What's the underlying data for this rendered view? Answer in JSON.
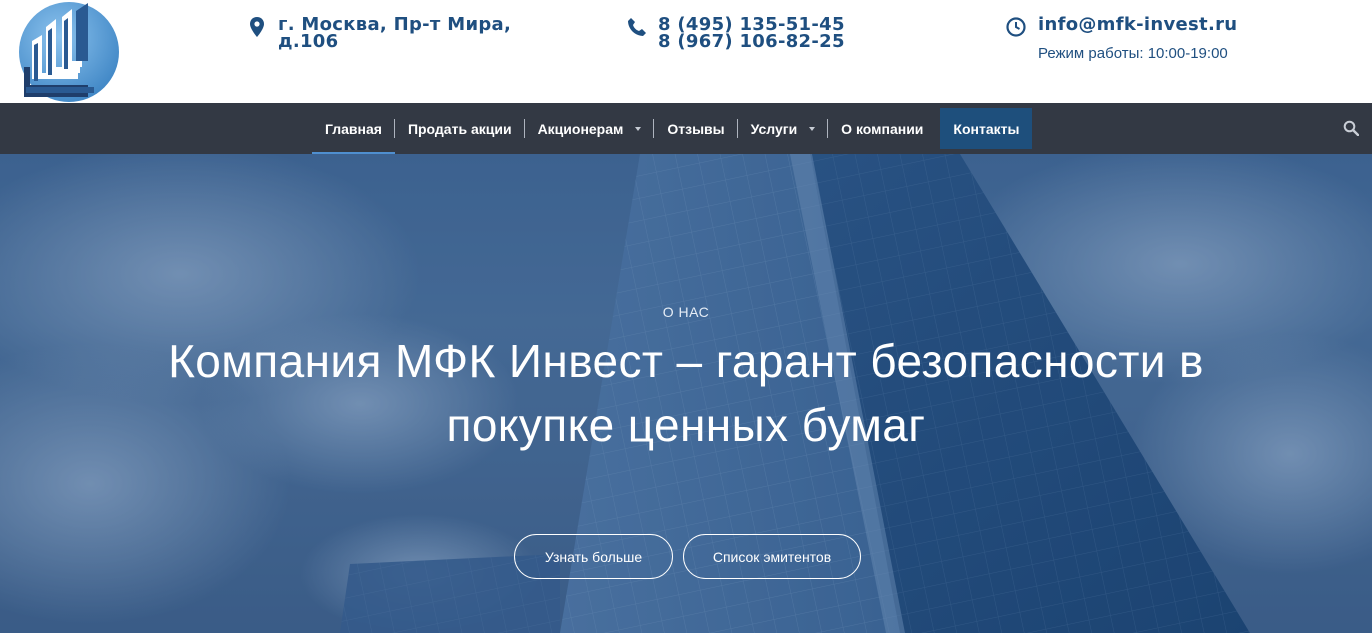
{
  "header": {
    "address": {
      "line1": "г. Москва, Пр-т Мира,",
      "line2": "д.106",
      "icon": "map-marker-icon"
    },
    "phones": {
      "line1": "8 (495) 135-51-45",
      "line2": "8 (967) 106-82-25",
      "icon": "phone-icon"
    },
    "contact": {
      "email": "info@mfk-invest.ru",
      "hours": "Режим работы: 10:00-19:00",
      "icon": "clock-icon"
    }
  },
  "nav": {
    "items": [
      {
        "label": "Главная",
        "dropdown": false,
        "active": true
      },
      {
        "label": "Продать акции",
        "dropdown": false
      },
      {
        "label": "Акционерам",
        "dropdown": true
      },
      {
        "label": "Отзывы",
        "dropdown": false
      },
      {
        "label": "Услуги",
        "dropdown": true
      },
      {
        "label": "О компании",
        "dropdown": false
      },
      {
        "label": "Контакты",
        "dropdown": false,
        "highlighted": true
      }
    ],
    "search_icon": "search-icon"
  },
  "hero": {
    "eyebrow": "О НАС",
    "title_line1": "Компания МФК Инвест – гарант безопасности в",
    "title_line2": "покупке ценных бумаг",
    "buttons": {
      "more": "Узнать больше",
      "issuers": "Список эмитентов"
    }
  },
  "colors": {
    "brand_blue": "#1f4f80",
    "nav_bg": "#333944",
    "nav_highlight": "#1e4f7c",
    "hero_tint": "#4a709c"
  }
}
